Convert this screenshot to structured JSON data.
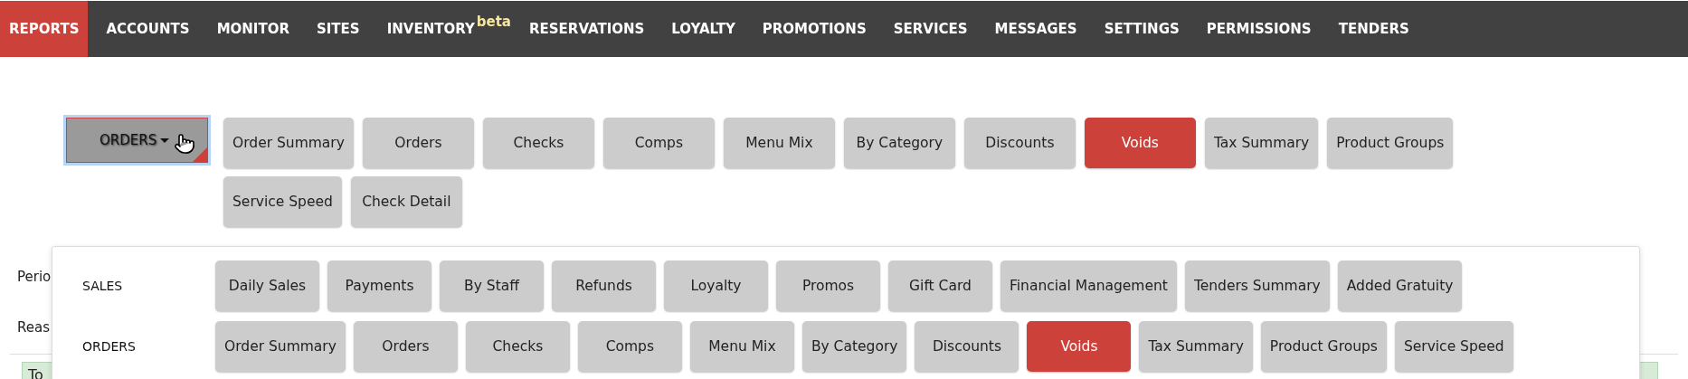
{
  "nav": [
    {
      "label": "REPORTS",
      "selected": true
    },
    {
      "label": "ACCOUNTS",
      "selected": false
    },
    {
      "label": "MONITOR",
      "selected": false
    },
    {
      "label": "SITES",
      "selected": false
    },
    {
      "label": "INVENTORY",
      "selected": false,
      "badge": "beta"
    },
    {
      "label": "RESERVATIONS",
      "selected": false
    },
    {
      "label": "LOYALTY",
      "selected": false
    },
    {
      "label": "PROMOTIONS",
      "selected": false
    },
    {
      "label": "SERVICES",
      "selected": false
    },
    {
      "label": "MESSAGES",
      "selected": false
    },
    {
      "label": "SETTINGS",
      "selected": false
    },
    {
      "label": "PERMISSIONS",
      "selected": false
    },
    {
      "label": "TENDERS",
      "selected": false
    }
  ],
  "report_group": {
    "label": "ORDERS",
    "expanded": true
  },
  "reports": [
    {
      "label": "Order Summary",
      "selected": false
    },
    {
      "label": "Orders",
      "selected": false
    },
    {
      "label": "Checks",
      "selected": false
    },
    {
      "label": "Comps",
      "selected": false
    },
    {
      "label": "Menu Mix",
      "selected": false
    },
    {
      "label": "By Category",
      "selected": false
    },
    {
      "label": "Discounts",
      "selected": false
    },
    {
      "label": "Voids",
      "selected": true
    },
    {
      "label": "Tax Summary",
      "selected": false
    },
    {
      "label": "Product Groups",
      "selected": false
    },
    {
      "label": "Service Speed",
      "selected": false
    },
    {
      "label": "Check Detail",
      "selected": false
    }
  ],
  "form_labels": [
    "Perio",
    "Reas"
  ],
  "notice": "To",
  "dropdown": {
    "groups": [
      {
        "label": "SALES",
        "items": [
          {
            "label": "Daily Sales",
            "selected": false
          },
          {
            "label": "Payments",
            "selected": false
          },
          {
            "label": "By Staff",
            "selected": false
          },
          {
            "label": "Refunds",
            "selected": false
          },
          {
            "label": "Loyalty",
            "selected": false
          },
          {
            "label": "Promos",
            "selected": false
          },
          {
            "label": "Gift Card",
            "selected": false
          },
          {
            "label": "Financial Management",
            "selected": false
          },
          {
            "label": "Tenders Summary",
            "selected": false
          },
          {
            "label": "Added Gratuity",
            "selected": false
          }
        ]
      },
      {
        "label": "ORDERS",
        "items": [
          {
            "label": "Order Summary",
            "selected": false
          },
          {
            "label": "Orders",
            "selected": false
          },
          {
            "label": "Checks",
            "selected": false
          },
          {
            "label": "Comps",
            "selected": false
          },
          {
            "label": "Menu Mix",
            "selected": false
          },
          {
            "label": "By Category",
            "selected": false
          },
          {
            "label": "Discounts",
            "selected": false
          },
          {
            "label": "Voids",
            "selected": true
          },
          {
            "label": "Tax Summary",
            "selected": false
          },
          {
            "label": "Product Groups",
            "selected": false
          },
          {
            "label": "Service Speed",
            "selected": false
          }
        ]
      }
    ]
  }
}
